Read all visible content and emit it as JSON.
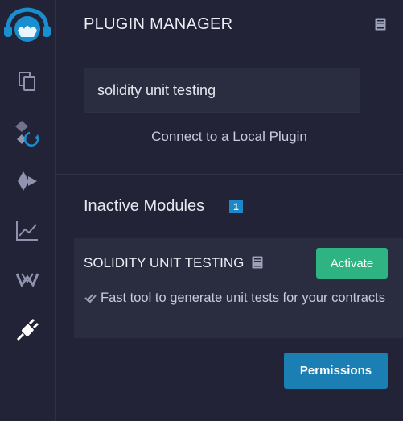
{
  "sidebar": {
    "items": [
      {
        "icon": "logo-icon"
      },
      {
        "icon": "file-explorer-icon"
      },
      {
        "icon": "compile-icon"
      },
      {
        "icon": "deploy-run-icon"
      },
      {
        "icon": "analytics-icon"
      },
      {
        "icon": "network-icon"
      },
      {
        "icon": "plugin-icon",
        "active": true
      }
    ]
  },
  "header": {
    "title": "PLUGIN MANAGER",
    "doc_icon": "documentation-icon"
  },
  "search": {
    "value": "solidity unit testing",
    "placeholder": ""
  },
  "local_plugin_link": "Connect to a Local Plugin",
  "inactive_section": {
    "title": "Inactive Modules",
    "count": "1"
  },
  "plugins": [
    {
      "name": "SOLIDITY UNIT TESTING",
      "doc_icon": "documentation-icon",
      "action_label": "Activate",
      "description_icon": "check-double-icon",
      "description": "Fast tool to generate unit tests for your contracts"
    }
  ],
  "footer": {
    "permissions_label": "Permissions"
  },
  "colors": {
    "background": "#222336",
    "card": "#2a2c3f",
    "accent_blue": "#1b7fb3",
    "badge_blue": "#1d87c7",
    "activate_green": "#2fb383",
    "icon_muted": "#8f93ad"
  }
}
